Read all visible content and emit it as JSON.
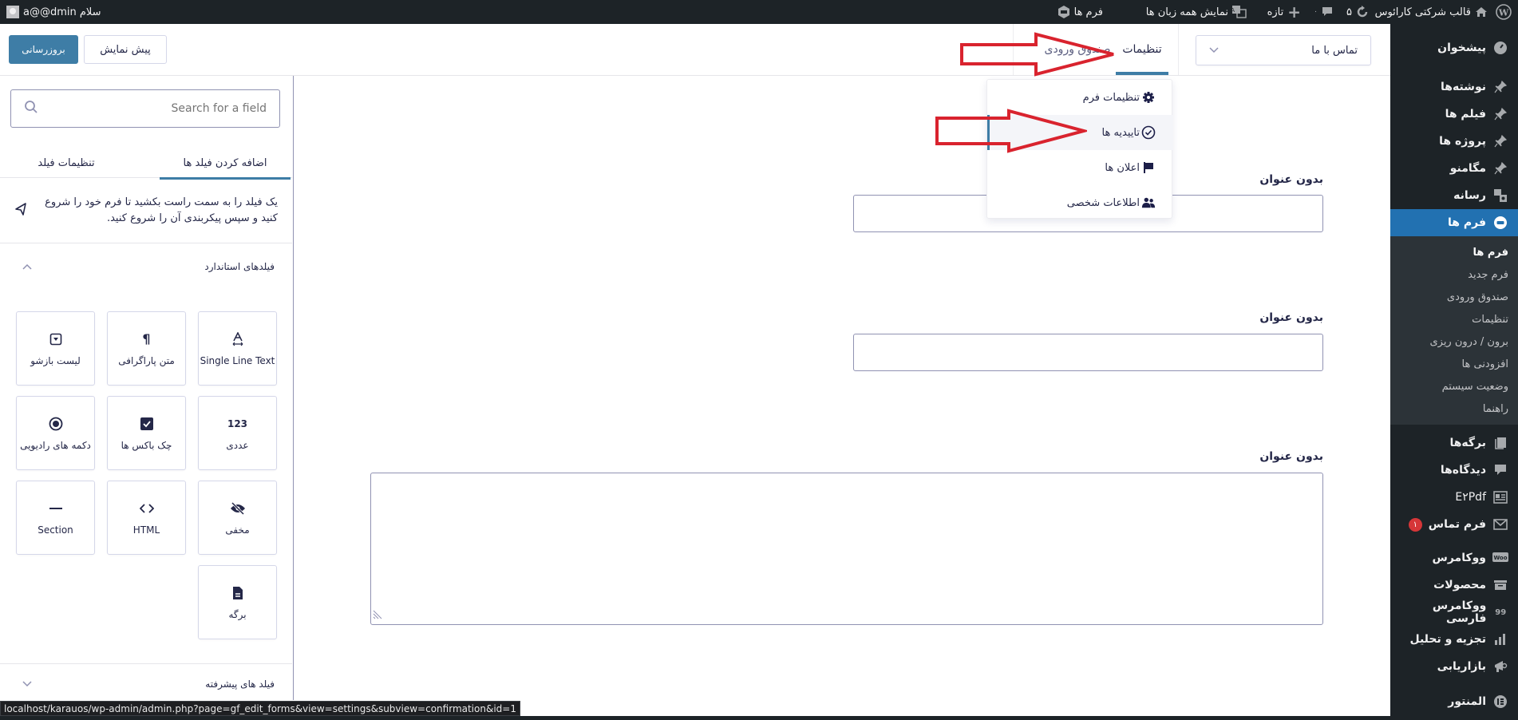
{
  "admin_bar": {
    "greeting": "سلام a@@dmin",
    "site_name": "قالب شرکتی کارائوس",
    "updates_count": "۵",
    "comments_count": "۰",
    "new_label": "تازه",
    "languages_label": "نمایش همه زبان ها",
    "forms_label": "فرم ها"
  },
  "sidebar": {
    "items": [
      {
        "label": "پیشخوان",
        "icon": "dashboard-icon"
      },
      {
        "label": "نوشته‌ها",
        "icon": "pin-icon"
      },
      {
        "label": "فیلم ها",
        "icon": "pin-icon"
      },
      {
        "label": "پروژه ها",
        "icon": "pin-icon"
      },
      {
        "label": "مگامنو",
        "icon": "pin-icon"
      },
      {
        "label": "رسانه",
        "icon": "media-icon"
      },
      {
        "label": "فرم ها",
        "icon": "gravity-forms-icon",
        "current": true
      }
    ],
    "submenu": [
      {
        "label": "فرم ها",
        "active": true
      },
      {
        "label": "فرم جدید"
      },
      {
        "label": "صندوق ورودی"
      },
      {
        "label": "تنظیمات"
      },
      {
        "label": "برون / درون ریزی"
      },
      {
        "label": "افزودنی ها"
      },
      {
        "label": "وضعیت سیستم"
      },
      {
        "label": "راهنما"
      }
    ],
    "items_after": [
      {
        "label": "برگه‌ها",
        "icon": "pages-icon"
      },
      {
        "label": "دیدگاه‌ها",
        "icon": "comments-icon"
      },
      {
        "label": "E۲Pdf",
        "icon": "pdf-icon"
      },
      {
        "label": "فرم تماس",
        "icon": "mail-icon",
        "badge": "۱"
      },
      {
        "label": "ووکامرس",
        "icon": "woo-icon"
      },
      {
        "label": "محصولات",
        "icon": "archive-icon"
      },
      {
        "label": "ووکامرس فارسی",
        "icon": "persian-woo-icon"
      },
      {
        "label": "تجزیه و تحلیل",
        "icon": "analytics-icon"
      },
      {
        "label": "بازاریابی",
        "icon": "megaphone-icon"
      },
      {
        "label": "المنتور",
        "icon": "elementor-icon"
      }
    ]
  },
  "topbar": {
    "form_selector": "تماس با ما",
    "tabs": [
      {
        "label": "تنظیمات",
        "active": true
      },
      {
        "label": "صندوق ورودی"
      }
    ],
    "preview_label": "پیش نمایش",
    "update_label": "بروزرسانی"
  },
  "settings_dropdown": {
    "items": [
      {
        "label": "تنظیمات فرم",
        "icon": "gear-icon"
      },
      {
        "label": "تاییدیه ها",
        "icon": "check-circle-icon",
        "selected": true
      },
      {
        "label": "اعلان ها",
        "icon": "flag-icon"
      },
      {
        "label": "اطلاعات شخصی",
        "icon": "users-icon"
      }
    ]
  },
  "panel": {
    "search_placeholder": "Search for a field",
    "tabs": [
      {
        "label": "اضافه کردن فیلد ها",
        "active": true
      },
      {
        "label": "تنظیمات فیلد"
      }
    ],
    "hint": "یک فیلد را به سمت راست بکشید تا فرم خود را شروع کنید و سپس پیکربندی آن را شروع کنید.",
    "standard_group": "فیلدهای استاندارد",
    "fields": [
      {
        "label": "Single Line Text",
        "icon": "text-icon"
      },
      {
        "label": "متن پاراگرافی",
        "icon": "paragraph-icon"
      },
      {
        "label": "لیست بازشو",
        "icon": "dropdown-icon"
      },
      {
        "label": "عددی",
        "icon": "number-icon",
        "icon_text": "123"
      },
      {
        "label": "چک باکس ها",
        "icon": "checkbox-icon"
      },
      {
        "label": "دکمه های رادیویی",
        "icon": "radio-icon"
      },
      {
        "label": "مخفی",
        "icon": "hidden-eye-icon"
      },
      {
        "label": "HTML",
        "icon": "code-icon",
        "icon_text": "<>"
      },
      {
        "label": "Section",
        "icon": "section-icon"
      },
      {
        "label": "برگه",
        "icon": "page-icon"
      }
    ],
    "advanced_group": "فیلد های پیشرفته"
  },
  "canvas": {
    "fields": [
      {
        "label": "بدون عنوان",
        "type": "text"
      },
      {
        "label": "بدون عنوان",
        "type": "text"
      },
      {
        "label": "بدون عنوان",
        "type": "textarea"
      }
    ]
  },
  "status_url": "localhost/karauos/wp-admin/admin.php?page=gf_edit_forms&view=settings&subview=confirmation&id=1",
  "colors": {
    "admin_dark": "#1d2327",
    "wp_blue": "#2271b1",
    "gf_blue": "#3e7da6",
    "annotation_red": "#d9232e"
  }
}
